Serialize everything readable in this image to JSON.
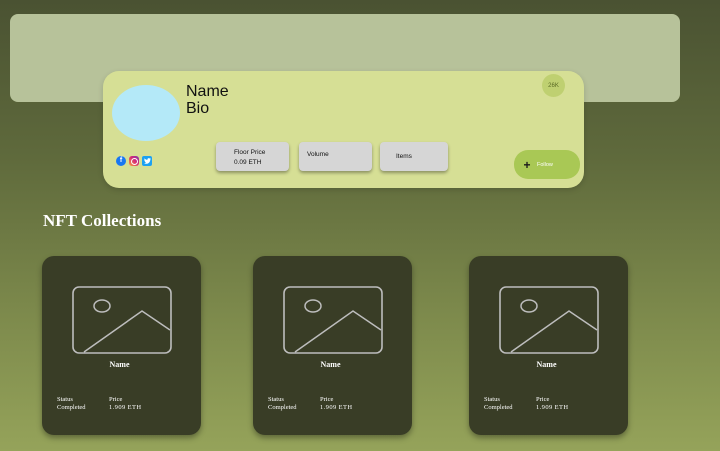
{
  "profile": {
    "name": "Name",
    "bio": "Bio",
    "count_badge": "26K",
    "socials": [
      {
        "icon": "facebook-icon",
        "color": "#1877f2"
      },
      {
        "icon": "instagram-icon",
        "color": "#d62976"
      },
      {
        "icon": "twitter-icon",
        "color": "#1da1f2"
      }
    ],
    "stats": {
      "floor_price_label": "Floor Price",
      "floor_price_value": "0.09 ETH",
      "volume_label": "Volume",
      "items_label": "Items"
    },
    "follow_button": {
      "label": "Follow",
      "icon": "plus-icon"
    }
  },
  "collections": {
    "title": "NFT Collections",
    "cards": [
      {
        "name": "Name",
        "status_label": "Status",
        "status_value": "Completed",
        "price_label": "Price",
        "price_value": "1.909 ETH"
      },
      {
        "name": "Name",
        "status_label": "Status",
        "status_value": "Completed",
        "price_label": "Price",
        "price_value": "1.909 ETH"
      },
      {
        "name": "Name",
        "status_label": "Status",
        "status_value": "Completed",
        "price_label": "Price",
        "price_value": "1.909 ETH"
      }
    ]
  },
  "colors": {
    "banner": "#b7c29a",
    "profile_card": "#d6df95",
    "avatar": "#b4e9f8",
    "follow_button": "#a9c855",
    "nft_card": "#393d26"
  }
}
